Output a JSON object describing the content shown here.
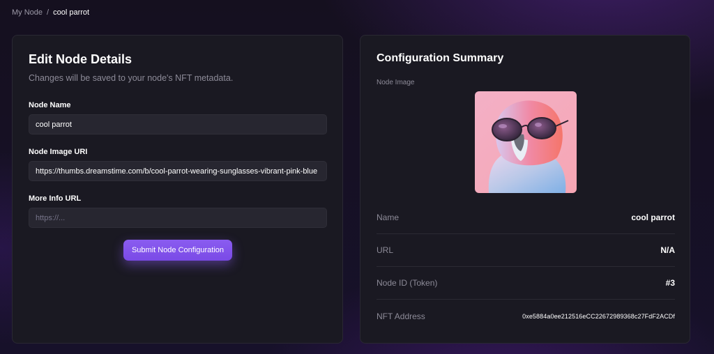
{
  "breadcrumb": {
    "parent": "My Node",
    "separator": "/",
    "current": "cool parrot"
  },
  "edit_card": {
    "title": "Edit Node Details",
    "subtitle": "Changes will be saved to your node's NFT metadata.",
    "fields": [
      {
        "label": "Node Name",
        "value": "cool parrot",
        "placeholder": ""
      },
      {
        "label": "Node Image URI",
        "value": "https://thumbs.dreamstime.com/b/cool-parrot-wearing-sunglasses-vibrant-pink-blue",
        "placeholder": ""
      },
      {
        "label": "More Info URL",
        "value": "",
        "placeholder": "https://..."
      }
    ],
    "submit_label": "Submit Node Configuration"
  },
  "summary_card": {
    "title": "Configuration Summary",
    "image_label": "Node Image",
    "rows": [
      {
        "key": "Name",
        "value": "cool parrot"
      },
      {
        "key": "URL",
        "value": "N/A"
      },
      {
        "key": "Node ID (Token)",
        "value": "#3"
      },
      {
        "key": "NFT Address",
        "value": "0xe5884a0ee212516eCC22672989368c27FdF2ACDf"
      }
    ]
  },
  "colors": {
    "accent": "#7a4ae6",
    "card_bg": "#1a1922",
    "input_bg": "#272630"
  }
}
